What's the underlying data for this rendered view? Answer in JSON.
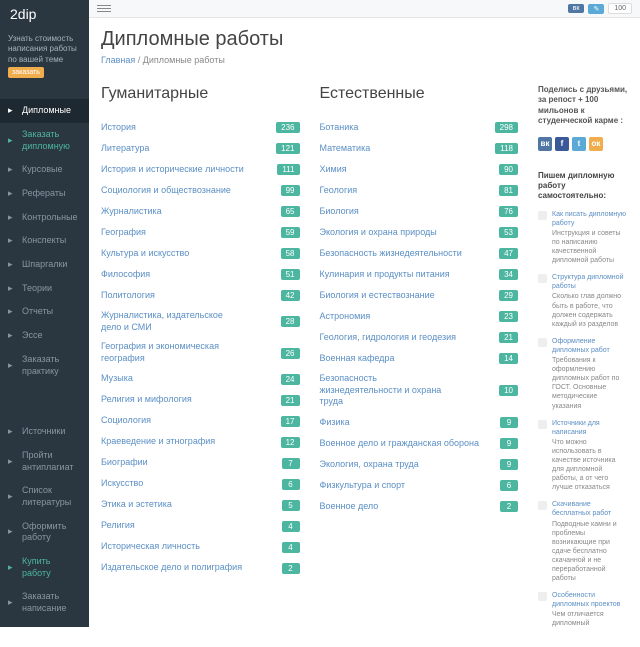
{
  "logo": "2dip",
  "promo_text": "Узнать стоимость написания работы по вашей теме",
  "promo_badge": "заказать",
  "nav1": [
    {
      "label": "Дипломные",
      "active": true
    },
    {
      "label": "Заказать дипломную",
      "highlight": true
    },
    {
      "label": "Курсовые"
    },
    {
      "label": "Рефераты"
    },
    {
      "label": "Контрольные"
    },
    {
      "label": "Конспекты"
    },
    {
      "label": "Шпаргалки"
    },
    {
      "label": "Теории"
    },
    {
      "label": "Отчеты"
    },
    {
      "label": "Эссе"
    },
    {
      "label": "Заказать практику"
    }
  ],
  "nav2": [
    {
      "label": "Источники"
    },
    {
      "label": "Пройти антиплагиат"
    },
    {
      "label": "Список литературы"
    },
    {
      "label": "Оформить работу"
    },
    {
      "label": "Купить работу",
      "highlight": true
    },
    {
      "label": "Заказать написание"
    }
  ],
  "topbar_count": "100",
  "page_title": "Дипломные работы",
  "breadcrumb_home": "Главная",
  "breadcrumb_current": "Дипломные работы",
  "col1_title": "Гуманитарные",
  "col1": [
    {
      "name": "История",
      "count": "236"
    },
    {
      "name": "Литература",
      "count": "121"
    },
    {
      "name": "История и исторические личности",
      "count": "111"
    },
    {
      "name": "Социология и обществознание",
      "count": "99"
    },
    {
      "name": "Журналистика",
      "count": "65"
    },
    {
      "name": "География",
      "count": "59"
    },
    {
      "name": "Культура и искусство",
      "count": "58"
    },
    {
      "name": "Философия",
      "count": "51"
    },
    {
      "name": "Политология",
      "count": "42"
    },
    {
      "name": "Журналистика, издательское дело и СМИ",
      "count": "28",
      "wrap": true
    },
    {
      "name": "География и экономическая география",
      "count": "26",
      "wrap": true
    },
    {
      "name": "Музыка",
      "count": "24"
    },
    {
      "name": "Религия и мифология",
      "count": "21"
    },
    {
      "name": "Социология",
      "count": "17"
    },
    {
      "name": "Краеведение и этнография",
      "count": "12"
    },
    {
      "name": "Биографии",
      "count": "7"
    },
    {
      "name": "Искусство",
      "count": "6"
    },
    {
      "name": "Этика и эстетика",
      "count": "5"
    },
    {
      "name": "Религия",
      "count": "4"
    },
    {
      "name": "Историческая личность",
      "count": "4"
    },
    {
      "name": "Издательское дело и полиграфия",
      "count": "2"
    }
  ],
  "col2_title": "Естественные",
  "col2": [
    {
      "name": "Ботаника",
      "count": "298"
    },
    {
      "name": "Математика",
      "count": "118"
    },
    {
      "name": "Химия",
      "count": "90"
    },
    {
      "name": "Геология",
      "count": "81"
    },
    {
      "name": "Биология",
      "count": "76"
    },
    {
      "name": "Экология и охрана природы",
      "count": "53"
    },
    {
      "name": "Безопасность жизнедеятельности",
      "count": "47"
    },
    {
      "name": "Кулинария и продукты питания",
      "count": "34"
    },
    {
      "name": "Биология и естествознание",
      "count": "29"
    },
    {
      "name": "Астрономия",
      "count": "23"
    },
    {
      "name": "Геология, гидрология и геодезия",
      "count": "21"
    },
    {
      "name": "Военная кафедра",
      "count": "14"
    },
    {
      "name": "Безопасность жизнедеятельности и охрана труда",
      "count": "10",
      "wrap": true
    },
    {
      "name": "Физика",
      "count": "9"
    },
    {
      "name": "Военное дело и гражданская оборона",
      "count": "9"
    },
    {
      "name": "Экология, охрана труда",
      "count": "9"
    },
    {
      "name": "Физкультура и спорт",
      "count": "6"
    },
    {
      "name": "Военное дело",
      "count": "2"
    }
  ],
  "share_text": "Поделись с друзьями, за репост + 100 мильонов к студенческой карме :",
  "tips_title": "Пишем дипломную работу самостоятельно:",
  "tips": [
    {
      "title": "Как писать дипломную работу",
      "desc": "Инструкция и советы по написанию качественной дипломной работы"
    },
    {
      "title": "Структура дипломной работы",
      "desc": "Сколько глав должно быть в работе, что должен содержать каждый из разделов"
    },
    {
      "title": "Оформление дипломных работ",
      "desc": "Требования к оформлению дипломных работ по ГОСТ. Основные методические указания"
    },
    {
      "title": "Источники для написания",
      "desc": "Что можно использовать в качестве источника для дипломной работы, а от чего лучше отказаться"
    },
    {
      "title": "Скачивание бесплатных работ",
      "desc": "Подводные камни и проблемы возникающие при сдаче бесплатно скачанной и не переработанной работы"
    },
    {
      "title": "Особенности дипломных проектов",
      "desc": "Чем отличается дипломный"
    }
  ]
}
